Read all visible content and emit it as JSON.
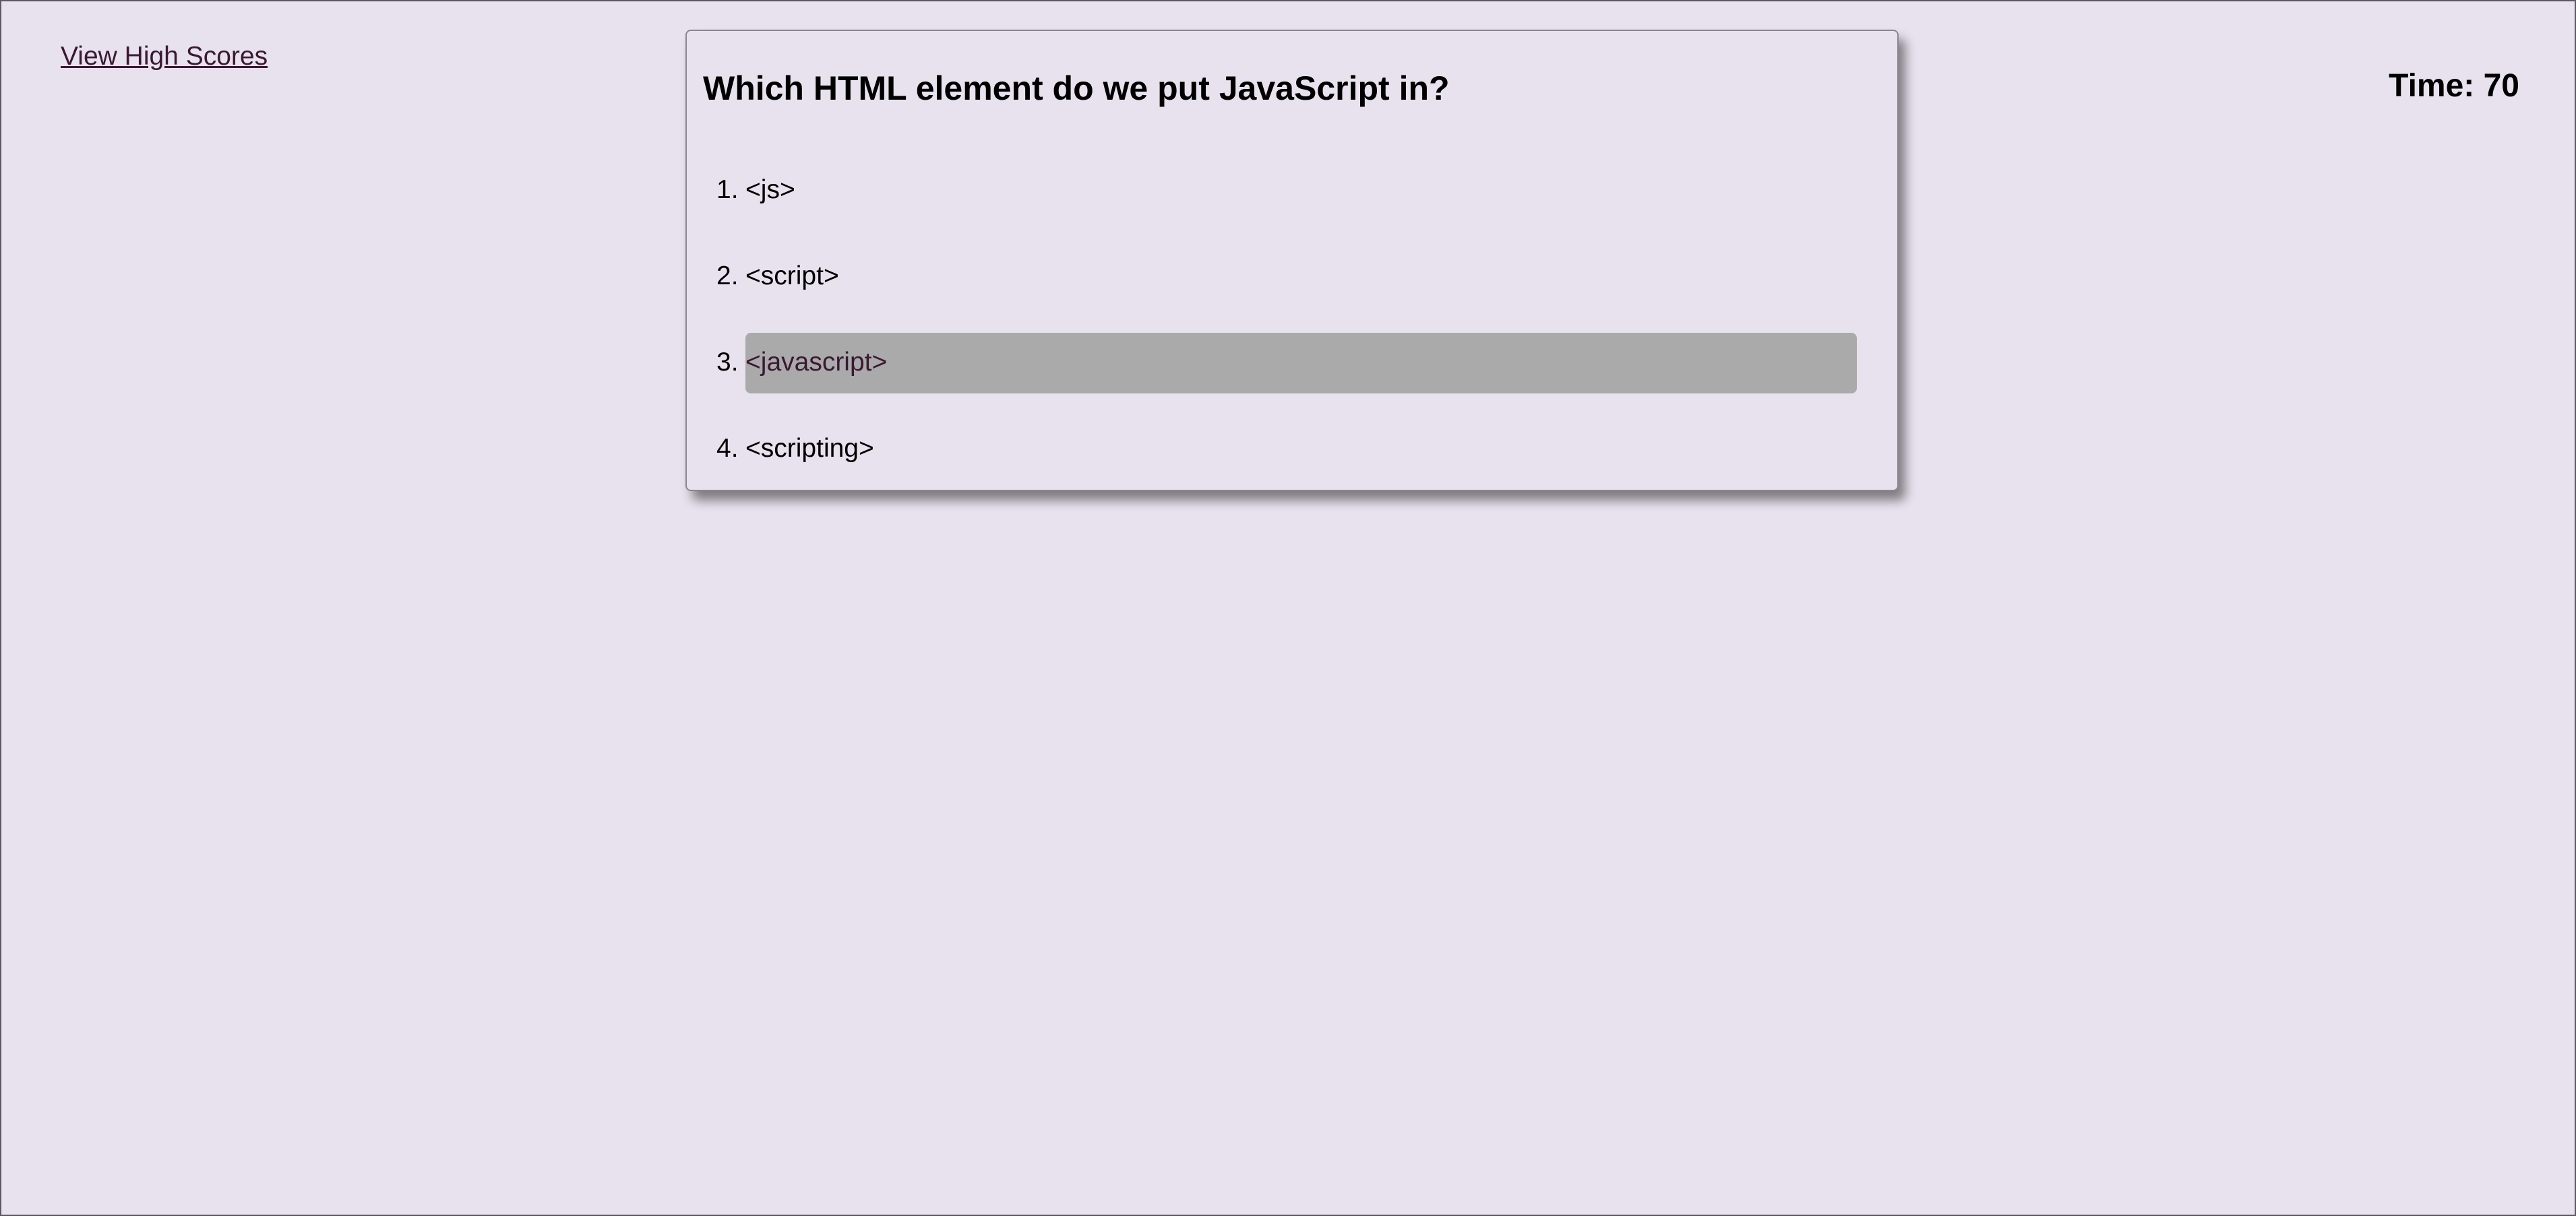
{
  "nav": {
    "high_scores_label": "View High Scores"
  },
  "timer": {
    "label": "Time: 70"
  },
  "quiz": {
    "question": "Which HTML element do we put JavaScript in?",
    "answers": [
      {
        "number": "1.",
        "text": "<js>"
      },
      {
        "number": "2.",
        "text": "<script>"
      },
      {
        "number": "3.",
        "text": "<javascript>"
      },
      {
        "number": "4.",
        "text": "<scripting>"
      }
    ],
    "hovered_answer": "<javascript>"
  },
  "colors": {
    "background": "#e8e2ee",
    "highlight": "#abaaab",
    "link": "#3a1a33"
  }
}
